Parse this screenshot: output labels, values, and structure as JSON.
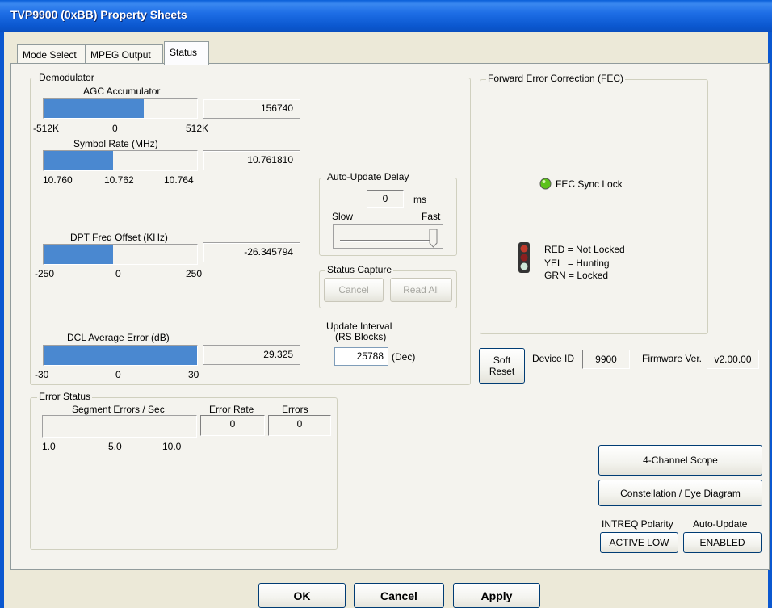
{
  "window": {
    "title": "TVP9900 (0xBB) Property Sheets"
  },
  "tabs": [
    {
      "label": "Mode Select"
    },
    {
      "label": "MPEG Output"
    },
    {
      "label": "Status"
    }
  ],
  "demodulator": {
    "group_label": "Demodulator",
    "agc": {
      "label": "AGC Accumulator",
      "value": "156740",
      "fill_fraction": 0.65,
      "ticks": [
        "-512K",
        "0",
        "512K"
      ]
    },
    "symbol_rate": {
      "label": "Symbol Rate (MHz)",
      "value": "10.761810",
      "fill_fraction": 0.45,
      "ticks": [
        "10.760",
        "10.762",
        "10.764"
      ]
    },
    "dpt": {
      "label": "DPT Freq Offset (KHz)",
      "value": "-26.345794",
      "fill_fraction": 0.45,
      "ticks": [
        "-250",
        "0",
        "250"
      ]
    },
    "dcl": {
      "label": "DCL Average Error (dB)",
      "value": "29.325",
      "fill_fraction": 1.0,
      "ticks": [
        "-30",
        "0",
        "30"
      ]
    }
  },
  "auto_update_delay": {
    "group_label": "Auto-Update Delay",
    "value": "0",
    "unit": "ms",
    "slow_label": "Slow",
    "fast_label": "Fast",
    "slider_level": 1.0
  },
  "status_capture": {
    "group_label": "Status Capture",
    "cancel_label": "Cancel",
    "read_all_label": "Read All"
  },
  "update_interval": {
    "label_line1": "Update Interval",
    "label_line2": "(RS Blocks)",
    "value": "25788",
    "unit": "(Dec)"
  },
  "fec": {
    "group_label": "Forward Error Correction (FEC)",
    "sync_lock_label": "FEC Sync Lock",
    "legend_red": "RED = Not Locked",
    "legend_yel": "YEL  = Hunting",
    "legend_grn": "GRN = Locked",
    "indicator_color": "#5cc21a"
  },
  "device": {
    "soft_reset_line1": "Soft",
    "soft_reset_line2": "Reset",
    "device_id_label": "Device ID",
    "device_id_value": "9900",
    "firmware_label": "Firmware Ver.",
    "firmware_value": "v2.00.00"
  },
  "error_status": {
    "group_label": "Error Status",
    "segment_label": "Segment Errors / Sec",
    "error_rate_label": "Error Rate",
    "error_rate_value": "0",
    "errors_label": "Errors",
    "errors_value": "0",
    "ticks": [
      "1.0",
      "5.0",
      "10.0"
    ],
    "fill_fraction": 0.0
  },
  "tools": {
    "scope_label": "4-Channel Scope",
    "constellation_label": "Constellation / Eye Diagram",
    "intreq_label": "INTREQ Polarity",
    "intreq_value": "ACTIVE LOW",
    "auto_update_label": "Auto-Update",
    "auto_update_value": "ENABLED"
  },
  "footer": {
    "ok_label": "OK",
    "cancel_label": "Cancel",
    "apply_label": "Apply"
  },
  "colors": {
    "accent": "#4a88d0",
    "titlebar": "#0b58d0"
  }
}
